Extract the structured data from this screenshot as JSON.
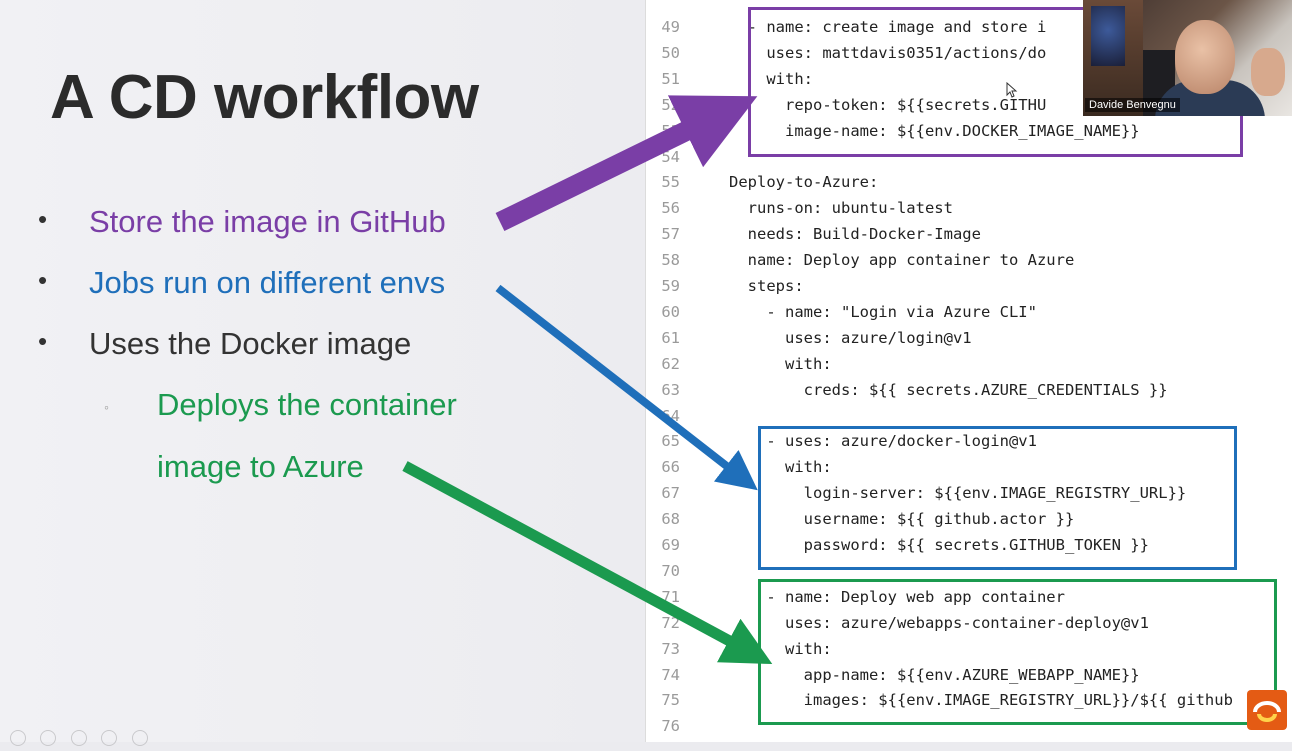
{
  "slide": {
    "title": "A CD workflow",
    "bullets": [
      {
        "text": "Store the image in GitHub",
        "color": "#7a3ea6"
      },
      {
        "text": "Jobs run on different envs",
        "color": "#1f6fba"
      },
      {
        "text": "Uses the Docker image",
        "color": "#333333"
      }
    ],
    "sub_bullet_lines": [
      "Deploys the container",
      "image to Azure"
    ],
    "sub_bullet_color": "#1b9a4f",
    "bullet_symbol": "•",
    "sub_bullet_symbol": "◦"
  },
  "code": {
    "lines": [
      {
        "n": "49",
        "text": "  - name: create image and store i"
      },
      {
        "n": "50",
        "text": "    uses: mattdavis0351/actions/do"
      },
      {
        "n": "51",
        "text": "    with:"
      },
      {
        "n": "52",
        "text": "      repo-token: ${{secrets.GITHU"
      },
      {
        "n": "53",
        "text": "      image-name: ${{env.DOCKER_IMAGE_NAME}}"
      },
      {
        "n": "54",
        "text": ""
      },
      {
        "n": "55",
        "text": "Deploy-to-Azure:"
      },
      {
        "n": "56",
        "text": "  runs-on: ubuntu-latest"
      },
      {
        "n": "57",
        "text": "  needs: Build-Docker-Image"
      },
      {
        "n": "58",
        "text": "  name: Deploy app container to Azure"
      },
      {
        "n": "59",
        "text": "  steps:"
      },
      {
        "n": "60",
        "text": "    - name: \"Login via Azure CLI\""
      },
      {
        "n": "61",
        "text": "      uses: azure/login@v1"
      },
      {
        "n": "62",
        "text": "      with:"
      },
      {
        "n": "63",
        "text": "        creds: ${{ secrets.AZURE_CREDENTIALS }}"
      },
      {
        "n": "64",
        "text": ""
      },
      {
        "n": "65",
        "text": "    - uses: azure/docker-login@v1"
      },
      {
        "n": "66",
        "text": "      with:"
      },
      {
        "n": "67",
        "text": "        login-server: ${{env.IMAGE_REGISTRY_URL}}"
      },
      {
        "n": "68",
        "text": "        username: ${{ github.actor }}"
      },
      {
        "n": "69",
        "text": "        password: ${{ secrets.GITHUB_TOKEN }}"
      },
      {
        "n": "70",
        "text": ""
      },
      {
        "n": "71",
        "text": "    - name: Deploy web app container"
      },
      {
        "n": "72",
        "text": "      uses: azure/webapps-container-deploy@v1"
      },
      {
        "n": "73",
        "text": "      with:"
      },
      {
        "n": "74",
        "text": "        app-name: ${{env.AZURE_WEBAPP_NAME}}"
      },
      {
        "n": "75",
        "text": "        images: ${{env.IMAGE_REGISTRY_URL}}/${{ github"
      },
      {
        "n": "76",
        "text": ""
      }
    ]
  },
  "highlights": {
    "purple": "#7a3ea6",
    "blue": "#1f6fba",
    "green": "#1b9a4f"
  },
  "webcam": {
    "presenter_name": "Davide Benvegnu"
  },
  "icons": {
    "logo": "presentation-logo-icon",
    "cursor": "mouse-cursor-icon"
  }
}
